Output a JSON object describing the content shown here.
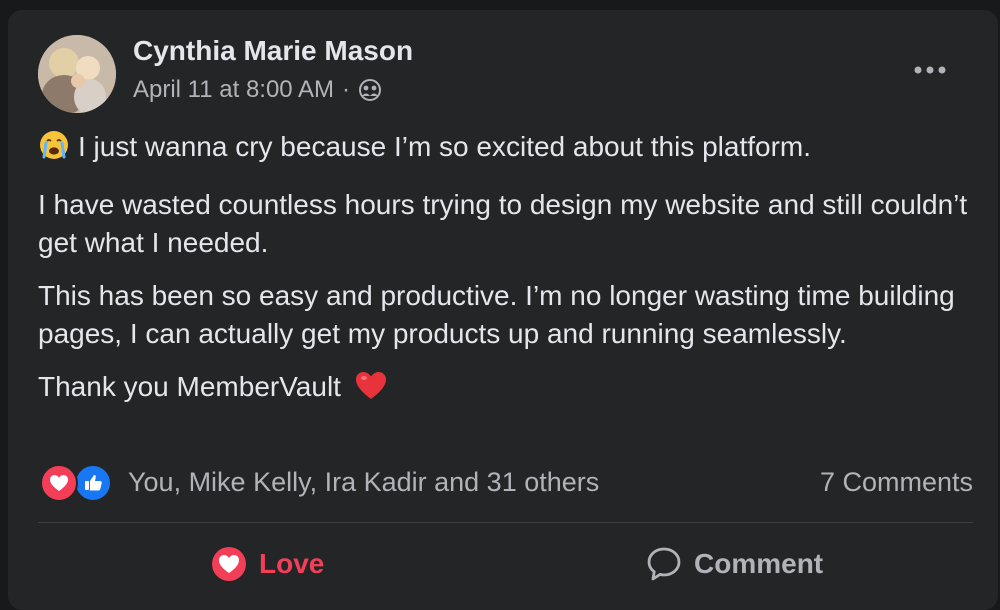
{
  "post": {
    "author": "Cynthia Marie Mason",
    "timestamp": "April 11 at 8:00 AM",
    "separator": "·",
    "audience_icon": "friends-icon",
    "more_icon": "more-horizontal-icon",
    "paragraphs": [
      "I just wanna cry because I’m so excited about this platform.",
      "I have wasted countless hours trying to design my website and still couldn’t get what I needed.",
      "This has been so easy and productive. I’m no longer wasting time building pages, I can actually get my products up and running seamlessly.",
      "Thank you MemberVault"
    ],
    "first_paragraph_emoji": "crying-face-icon",
    "last_paragraph_emoji": "red-heart-icon"
  },
  "reactions": {
    "icons": [
      "love-reaction-icon",
      "like-reaction-icon"
    ],
    "summary": "You, Mike Kelly, Ira Kadir and 31 others",
    "comments": "7 Comments"
  },
  "actions": {
    "love_label": "Love",
    "comment_label": "Comment"
  },
  "colors": {
    "background": "#18191a",
    "card": "#242526",
    "primary_text": "#e4e6eb",
    "secondary_text": "#b0b3b8",
    "love": "#f33e58",
    "like": "#1877f2",
    "divider": "#3e4042"
  }
}
